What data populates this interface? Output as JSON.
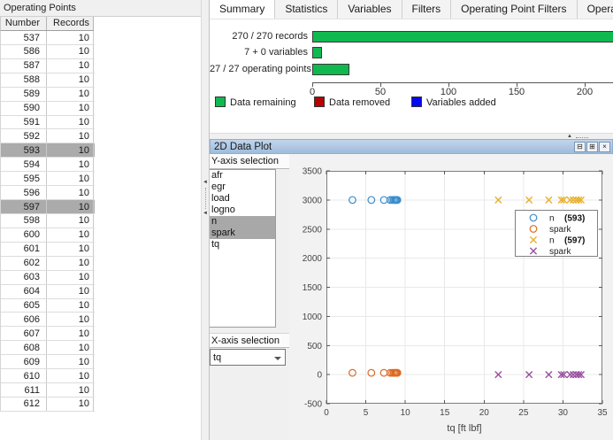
{
  "icons": {
    "collapse_left": "◄",
    "collapse_up": "▲",
    "dock": "⊟",
    "undock": "⊞",
    "close": "×"
  },
  "left_panel": {
    "title": "Operating Points",
    "columns": [
      "Number",
      "Records"
    ],
    "rows": [
      [
        537,
        10
      ],
      [
        586,
        10
      ],
      [
        587,
        10
      ],
      [
        588,
        10
      ],
      [
        589,
        10
      ],
      [
        590,
        10
      ],
      [
        591,
        10
      ],
      [
        592,
        10
      ],
      [
        593,
        10
      ],
      [
        594,
        10
      ],
      [
        595,
        10
      ],
      [
        596,
        10
      ],
      [
        597,
        10
      ],
      [
        598,
        10
      ],
      [
        600,
        10
      ],
      [
        601,
        10
      ],
      [
        602,
        10
      ],
      [
        603,
        10
      ],
      [
        604,
        10
      ],
      [
        605,
        10
      ],
      [
        606,
        10
      ],
      [
        607,
        10
      ],
      [
        608,
        10
      ],
      [
        609,
        10
      ],
      [
        610,
        10
      ],
      [
        611,
        10
      ],
      [
        612,
        10
      ]
    ],
    "selected_numbers": [
      593,
      597
    ]
  },
  "tabs": [
    "Summary",
    "Statistics",
    "Variables",
    "Filters",
    "Operating Point Filters",
    "Operating Point Notes"
  ],
  "active_tab": "Summary",
  "plot_panel": {
    "title": "2D Data Plot",
    "y_axis_label": "Y-axis selection",
    "y_axis_items": [
      "afr",
      "egr",
      "load",
      "logno",
      "n",
      "spark",
      "tq"
    ],
    "y_axis_selected": [
      "n",
      "spark"
    ],
    "x_axis_label": "X-axis selection",
    "x_axis_value": "tq"
  },
  "chart_data": [
    {
      "id": "summary-bars",
      "type": "bar",
      "orientation": "horizontal",
      "categories": [
        "270 / 270 records",
        "7 + 0 variables",
        "27 / 27 operating points"
      ],
      "values": [
        270,
        7,
        27
      ],
      "bar_color": "#0fb94f",
      "xticks": [
        0,
        50,
        100,
        150,
        200
      ],
      "xlim": [
        0,
        220
      ],
      "legend_position": "bottom",
      "legend": [
        {
          "label": "Data remaining",
          "color": "#0fb94f"
        },
        {
          "label": "Data removed",
          "color": "#b80000"
        },
        {
          "label": "Variables added",
          "color": "#0808f0"
        }
      ]
    },
    {
      "id": "2d-scatter",
      "type": "scatter",
      "title": "",
      "xlabel": "tq [ft lbf]",
      "ylabel": "",
      "xlim": [
        0,
        35
      ],
      "ylim": [
        -500,
        3500
      ],
      "xticks": [
        0,
        5,
        10,
        15,
        20,
        25,
        30,
        35
      ],
      "yticks": [
        -500,
        0,
        500,
        1000,
        1500,
        2000,
        2500,
        3000,
        3500
      ],
      "grid": true,
      "legend_position": "northeast-inside",
      "series": [
        {
          "name": "n (593)",
          "marker": "circle",
          "color": "#3a8dcc",
          "x": [
            3.3,
            5.7,
            7.3,
            8.1,
            8.35,
            8.55,
            8.7,
            8.8,
            8.9,
            9.0
          ],
          "y": [
            3000,
            3000,
            3000,
            3000,
            3000,
            3000,
            3000,
            3000,
            3000,
            3000
          ]
        },
        {
          "name": "spark (593)",
          "marker": "circle",
          "color": "#dd6b24",
          "x": [
            3.3,
            5.7,
            7.3,
            8.1,
            8.35,
            8.55,
            8.7,
            8.8,
            8.9,
            9.0
          ],
          "y": [
            30,
            30,
            30,
            30,
            30,
            30,
            30,
            30,
            30,
            30
          ]
        },
        {
          "name": "n (597)",
          "marker": "x",
          "color": "#e9b02e",
          "x": [
            21.8,
            25.7,
            28.2,
            29.8,
            30.1,
            30.9,
            31.3,
            31.7,
            32.0,
            32.3
          ],
          "y": [
            3000,
            3000,
            3000,
            3000,
            3000,
            3000,
            3000,
            3000,
            3000,
            3000
          ]
        },
        {
          "name": "spark (597)",
          "marker": "x",
          "color": "#994f9e",
          "x": [
            21.8,
            25.7,
            28.2,
            29.8,
            30.1,
            30.9,
            31.3,
            31.7,
            32.0,
            32.3
          ],
          "y": [
            0,
            0,
            0,
            0,
            0,
            0,
            0,
            0,
            0,
            0
          ]
        }
      ],
      "legend": [
        {
          "name": "n",
          "tag": "(593)",
          "marker": "circle",
          "color": "#3a8dcc"
        },
        {
          "name": "spark",
          "tag": "",
          "marker": "circle",
          "color": "#dd6b24"
        },
        {
          "name": "n",
          "tag": "(597)",
          "marker": "x",
          "color": "#e9b02e"
        },
        {
          "name": "spark",
          "tag": "",
          "marker": "x",
          "color": "#994f9e"
        }
      ]
    }
  ]
}
